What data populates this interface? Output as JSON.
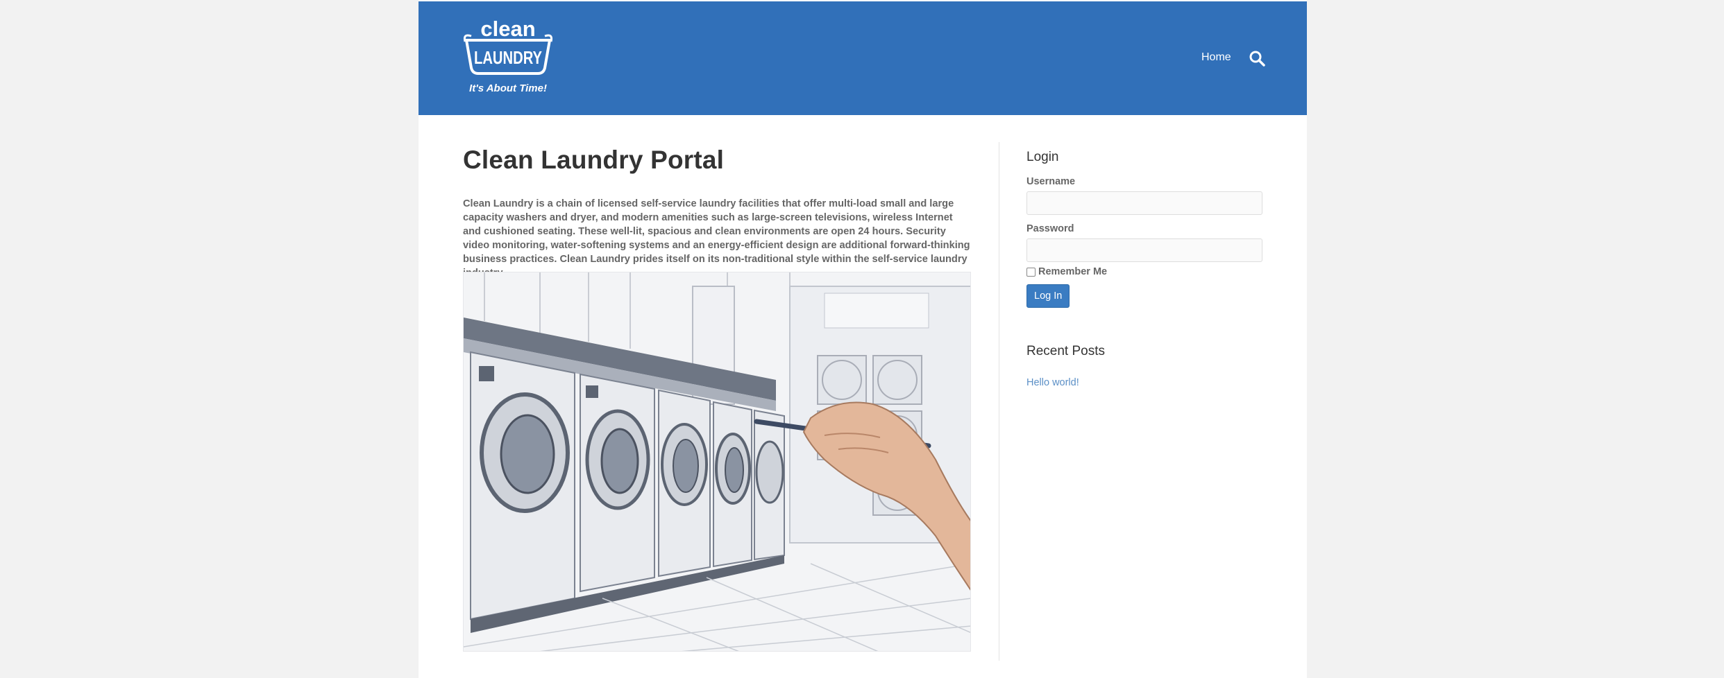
{
  "header": {
    "logo": {
      "word_top": "clean",
      "word_bottom": "LAUNDRY",
      "tagline": "It's About Time!"
    },
    "nav": {
      "home_label": "Home"
    },
    "search_icon": "search-icon"
  },
  "main": {
    "title": "Clean Laundry Portal",
    "intro": "Clean Laundry is a chain of licensed self-service laundry facilities that offer multi-load small and large capacity washers and dryer, and modern amenities such as large-screen televisions, wireless Internet and cushioned seating. These well-lit, spacious and clean environments are open 24 hours. Security video monitoring, water-softening systems and an energy-efficient design are additional forward-thinking business practices. Clean Laundry prides itself on its non-traditional style within the self-service laundry industry.",
    "hero_image": "laundromat-washers-sketch-with-hand-holding-pencil"
  },
  "sidebar": {
    "login": {
      "title": "Login",
      "username_label": "Username",
      "password_label": "Password",
      "remember_label": "Remember Me",
      "button_label": "Log In"
    },
    "recent_posts": {
      "title": "Recent Posts",
      "items": [
        {
          "label": "Hello world!"
        }
      ]
    }
  },
  "colors": {
    "header_bg": "#3170b9",
    "page_bg": "#f2f2f2",
    "button_bg": "#3a7cc2",
    "link": "#5b8fc6"
  }
}
